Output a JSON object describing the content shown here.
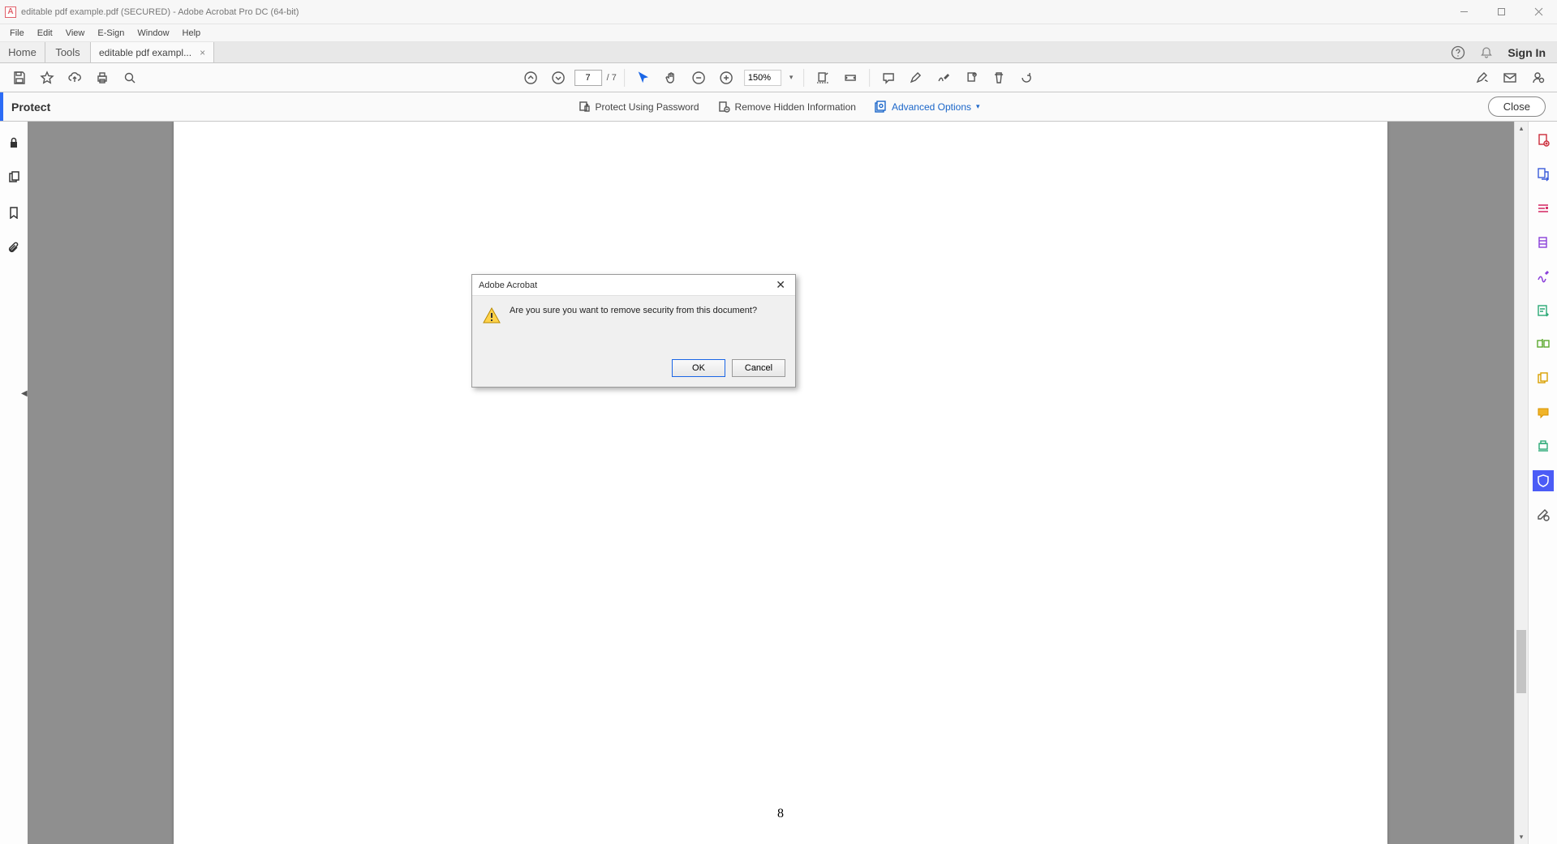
{
  "window": {
    "title": "editable pdf example.pdf (SECURED) - Adobe Acrobat Pro DC (64-bit)"
  },
  "menu": {
    "items": [
      "File",
      "Edit",
      "View",
      "E-Sign",
      "Window",
      "Help"
    ]
  },
  "tabs": {
    "home": "Home",
    "tools": "Tools",
    "doc": "editable pdf exampl..."
  },
  "signin": "Sign In",
  "toolbar": {
    "page_current": "7",
    "page_total": "/ 7",
    "zoom": "150%"
  },
  "protect": {
    "title": "Protect",
    "password": "Protect Using Password",
    "remove": "Remove Hidden Information",
    "advanced": "Advanced Options",
    "close": "Close"
  },
  "page": {
    "number": "8"
  },
  "dialog": {
    "title": "Adobe Acrobat",
    "message": "Are you sure you want to remove security from this document?",
    "ok": "OK",
    "cancel": "Cancel"
  }
}
